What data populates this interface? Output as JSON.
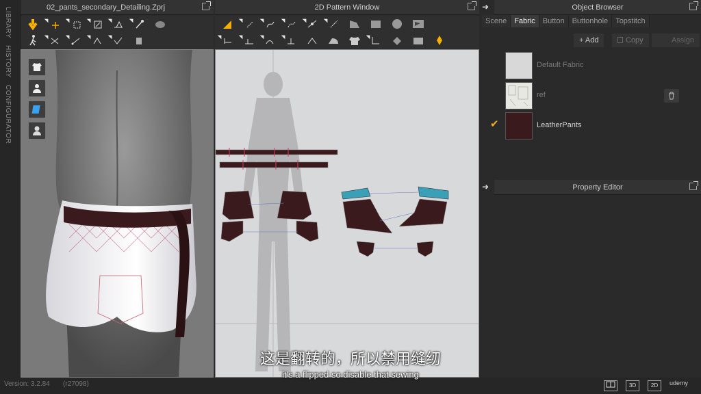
{
  "vertical_tabs": [
    "LIBRARY",
    "HISTORY",
    "CONFIGURATOR"
  ],
  "window3d": {
    "title": "02_pants_secondary_Detailing.Zprj"
  },
  "window2d": {
    "title": "2D Pattern Window"
  },
  "object_browser": {
    "title": "Object Browser",
    "tabs": [
      "Scene",
      "Fabric",
      "Button",
      "Buttonhole",
      "Topstitch"
    ],
    "active_tab": "Fabric",
    "add_label": "+ Add",
    "copy_label": "Copy",
    "assign_label": "Assign",
    "fabrics": [
      {
        "name": "Default Fabric",
        "swatch": "#d8d8d8",
        "checked": false
      },
      {
        "name": "ref",
        "swatch": "#e6e6e0",
        "checked": false
      },
      {
        "name": "LeatherPants",
        "swatch": "#3a1a1c",
        "checked": true
      }
    ]
  },
  "property_editor": {
    "title": "Property Editor"
  },
  "status": {
    "version": "Version: 3.2.84",
    "build": "(r27098)"
  },
  "view_modes": [
    "3D",
    "2D"
  ],
  "subtitles": {
    "chinese": "这是翻转的，所以禁用缝纫",
    "english": "it's a flipped so disable that sewing"
  },
  "watermark": "udemy",
  "colors": {
    "accent": "#f0b020",
    "leather": "#3b1a1d",
    "mesh": "#3aa0b8"
  }
}
